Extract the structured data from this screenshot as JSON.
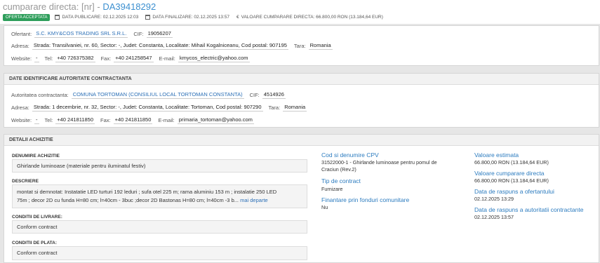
{
  "header": {
    "title_prefix": "cumparare directa: [nr] - ",
    "title_code": "DA39418292",
    "badge": "OFERTA ACCEPTATA",
    "date_publicare": "DATA PUBLICARE: 02.12.2025 12:03",
    "date_finalizare": "DATA FINALIZARE: 02.12.2025 13:57",
    "valoare": "VALOARE CUMPARARE DIRECTA: 66.800,00   RON (13.184,64  EUR)"
  },
  "ofertant": {
    "label": "Ofertant:",
    "name": "S.C. KMY&COS TRADING SRL S.R.L.",
    "cif_label": "CIF:",
    "cif": "19056207",
    "adresa_label": "Adresa:",
    "adresa": "Strada: Transilvaniei, nr. 60, Sector: -, Judet: Constanta, Localitate: Mihail Kogalniceanu, Cod postal: 907195",
    "tara_label": "Tara:",
    "tara": "Romania",
    "website_label": "Website:",
    "website": "-",
    "tel_label": "Tel:",
    "tel": "+40 726375382",
    "fax_label": "Fax:",
    "fax": "+40 241258547",
    "email_label": "E-mail:",
    "email": "kmycos_electric@yahoo.com"
  },
  "autoritate": {
    "heading": "DATE IDENTIFICARE AUTORITATE CONTRACTANTA",
    "label": "Autoritatea contractanta:",
    "name": "COMUNA TORTOMAN (CONSILIUL LOCAL TORTOMAN CONSTANTA)",
    "cif_label": "CIF:",
    "cif": "4514926",
    "adresa_label": "Adresa:",
    "adresa": "Strada: 1 decembrie, nr. 32, Sector: -, Judet: Constanta, Localitate: Tortoman, Cod postal: 907290",
    "tara_label": "Tara:",
    "tara": "Romania",
    "website_label": "Website:",
    "website": "-",
    "tel_label": "Tel:",
    "tel": "+40 241811850",
    "fax_label": "Fax:",
    "fax": "+40 241811850",
    "email_label": "E-mail:",
    "email": "primaria_tortoman@yahoo.com"
  },
  "achizitie": {
    "heading": "DETALII ACHIZITIE",
    "denumire_label": "DENUMIRE ACHIZITIE",
    "denumire": "Ghirlande luminoase (materiale pentru iluminatul festiv)",
    "descriere_label": "DESCRIERE",
    "descriere_line1": "montat si demnotat: Instatatie LED turturi 192 leduri ; sufa otel 225 m; rama aluminiu 153 m ; instalatie 250 LED",
    "descriere_line2": "75m ; decor 2D cu funda H=80 cm; l=40cm - 3buc ;decor 2D Bastonas H=80 cm; l=40cm -3 b...",
    "mai_departe": "mai departe",
    "livrare_label": "CONDITII DE LIVRARE:",
    "livrare": "Conform contract",
    "plata_label": "CONDITII DE PLATA:",
    "plata": "Conform contract",
    "cpv_label": "Cod si denumire CPV",
    "cpv_line1": "31522000-1 - Ghirlande luminoase pentru pomul de",
    "cpv_line2": "Craciun (Rev.2)",
    "tip_label": "Tip de contract",
    "tip": "Furnizare",
    "fonduri_label": "Finantare prin fonduri comunitare",
    "fonduri": "Nu",
    "val_estimata_label": "Valoare estimata",
    "val_estimata": "66.800,00   RON (13.184,64  EUR)",
    "val_cumparare_label": "Valoare cumparare directa",
    "val_cumparare": "66.800,00   RON (13.184,64  EUR)",
    "raspuns_ofertant_label": "Data de raspuns a ofertantului",
    "raspuns_ofertant": "02.12.2025 13:29",
    "raspuns_autoritate_label": "Data de raspuns a autoritatii contractante",
    "raspuns_autoritate": "02.12.2025 13:57"
  }
}
